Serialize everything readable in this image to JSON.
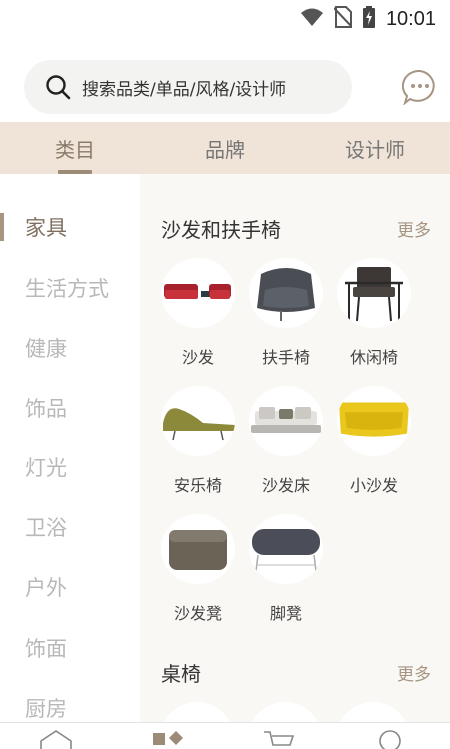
{
  "status": {
    "time": "10:01"
  },
  "search": {
    "placeholder": "搜索品类/单品/风格/设计师"
  },
  "tabs": [
    {
      "label": "类目",
      "active": true
    },
    {
      "label": "品牌",
      "active": false
    },
    {
      "label": "设计师",
      "active": false
    }
  ],
  "sidebar": {
    "items": [
      {
        "label": "家具",
        "active": true
      },
      {
        "label": "生活方式"
      },
      {
        "label": "健康"
      },
      {
        "label": "饰品"
      },
      {
        "label": "灯光"
      },
      {
        "label": "卫浴"
      },
      {
        "label": "户外"
      },
      {
        "label": "饰面"
      },
      {
        "label": "厨房"
      }
    ]
  },
  "sections": [
    {
      "title": "沙发和扶手椅",
      "more": "更多",
      "items": [
        {
          "label": "沙发",
          "icon": "red-sofa-image"
        },
        {
          "label": "扶手椅",
          "icon": "grey-armchair-image"
        },
        {
          "label": "休闲椅",
          "icon": "leather-lounge-chair-image"
        },
        {
          "label": "安乐椅",
          "icon": "chaise-lounge-image"
        },
        {
          "label": "沙发床",
          "icon": "sofa-bed-image"
        },
        {
          "label": "小沙发",
          "icon": "yellow-small-sofa-image"
        },
        {
          "label": "沙发凳",
          "icon": "pouf-image"
        },
        {
          "label": "脚凳",
          "icon": "footstool-image"
        }
      ]
    },
    {
      "title": "桌椅",
      "more": "更多"
    }
  ],
  "colors": {
    "accent": "#9c8b76",
    "tab_bar": "#efe4d7",
    "content_bg": "#faf8f5",
    "sidebar_inactive": "#b8b8b8"
  }
}
